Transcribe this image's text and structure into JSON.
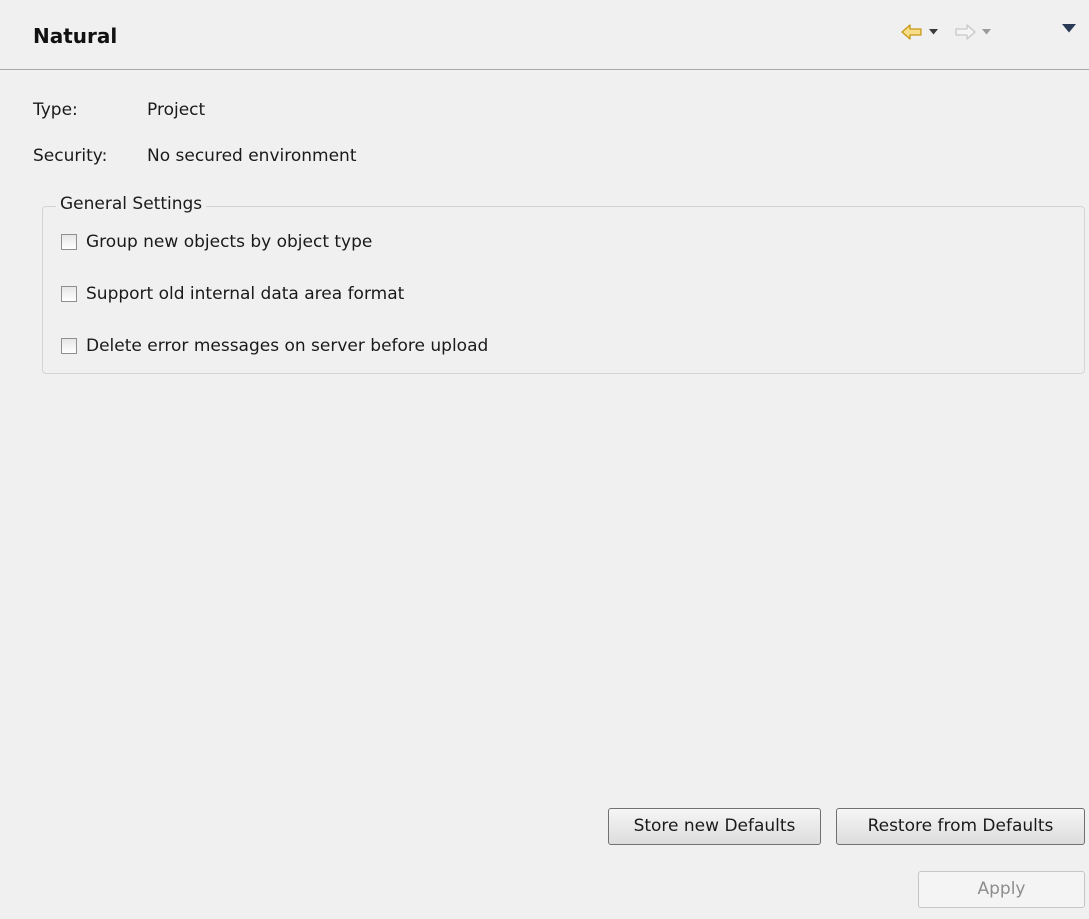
{
  "header": {
    "title": "Natural",
    "icons": {
      "back": "back-arrow-icon",
      "back_dropdown": "chevron-down-icon",
      "forward": "forward-arrow-icon",
      "forward_dropdown": "chevron-down-icon",
      "view_menu": "view-menu-icon"
    },
    "colors": {
      "back_arrow_fill": "#f7dc8a",
      "back_arrow_stroke": "#c79a14",
      "forward_arrow_disabled": "#c8c8c8"
    }
  },
  "info": {
    "type_label": "Type:",
    "type_value": "Project",
    "security_label": "Security:",
    "security_value": "No secured environment"
  },
  "general_settings": {
    "legend": "General Settings",
    "options": [
      {
        "label": "Group new objects by object type",
        "checked": false
      },
      {
        "label": "Support old internal data area format",
        "checked": false
      },
      {
        "label": "Delete error messages on server before upload",
        "checked": false
      }
    ]
  },
  "buttons": {
    "store_defaults": "Store new Defaults",
    "restore_defaults": "Restore from Defaults",
    "apply": "Apply",
    "apply_enabled": false
  }
}
